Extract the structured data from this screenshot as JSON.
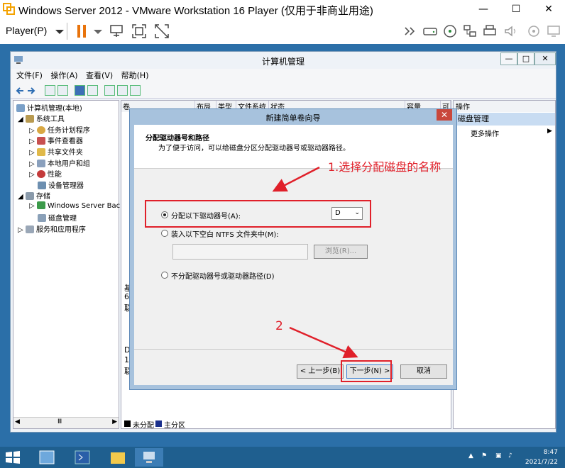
{
  "vm": {
    "title": "Windows Server 2012 - VMware Workstation 16 Player (仅用于非商业用途)",
    "player_menu": "Player(P)",
    "min": "—",
    "max": "☐",
    "close": "✕"
  },
  "cm": {
    "title": "计算机管理",
    "menu": [
      "文件(F)",
      "操作(A)",
      "查看(V)",
      "帮助(H)"
    ],
    "tree": [
      "计算机管理(本地)",
      "系统工具",
      "任务计划程序",
      "事件查看器",
      "共享文件夹",
      "本地用户和组",
      "性能",
      "设备管理器",
      "存储",
      "Windows Server Back",
      "磁盘管理",
      "服务和应用程序"
    ],
    "columns": [
      "卷",
      "布局",
      "类型",
      "文件系统",
      "状态",
      "容量",
      "可"
    ],
    "disk_side": [
      "基",
      "6",
      "联",
      "D",
      "1",
      "联"
    ],
    "legend": {
      "unalloc": "未分配",
      "primary": "主分区"
    },
    "actions": {
      "header": "操作",
      "selected": "磁盘管理",
      "more": "更多操作"
    }
  },
  "wizard": {
    "title": "新建简单卷向导",
    "heading": "分配驱动器号和路径",
    "subheading": "为了便于访问，可以给磁盘分区分配驱动器号或驱动器路径。",
    "option1": "分配以下驱动器号(A):",
    "drive_letter": "D",
    "option2": "装入以下空白 NTFS 文件夹中(M):",
    "browse": "浏览(R)...",
    "option3": "不分配驱动器号或驱动器路径(D)",
    "back": "< 上一步(B)",
    "next": "下一步(N) >",
    "cancel": "取消"
  },
  "annotations": {
    "step1": "1.选择分配磁盘的名称",
    "step2": "2"
  },
  "tray": {
    "time": "8:47",
    "date": "2021/7/22"
  },
  "colors": {
    "annotation": "#e0202a",
    "desktop": "#2b6fa8",
    "taskbar": "#1f5f8f"
  }
}
